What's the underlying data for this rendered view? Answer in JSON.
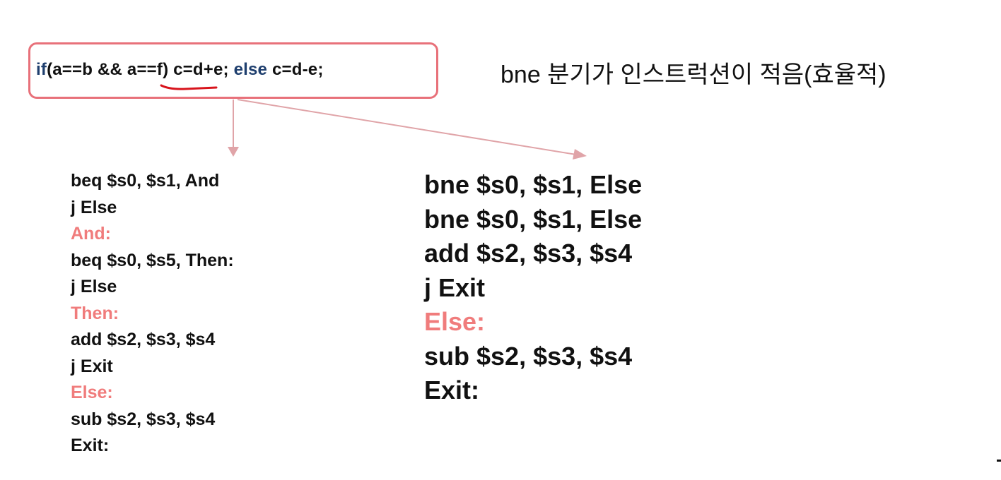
{
  "code": {
    "kw_if": "if",
    "part1": "(a==b && ",
    "underlined": "a==f",
    "part2": ") c=d+e; ",
    "kw_else": "else",
    "part3": " c=d-e;"
  },
  "note": "bne 분기가 인스트럭션이 적음(효율적)",
  "left_asm": [
    {
      "text": "beq $s0, $s1, And",
      "type": "instr"
    },
    {
      "text": "j Else",
      "type": "instr"
    },
    {
      "text": "And:",
      "type": "label"
    },
    {
      "text": "beq $s0, $s5, Then:",
      "type": "instr"
    },
    {
      "text": "j Else",
      "type": "instr"
    },
    {
      "text": "Then:",
      "type": "label"
    },
    {
      "text": "add $s2, $s3, $s4",
      "type": "instr"
    },
    {
      "text": "j Exit",
      "type": "instr"
    },
    {
      "text": "Else:",
      "type": "label"
    },
    {
      "text": "sub $s2, $s3, $s4",
      "type": "instr"
    },
    {
      "text": "Exit:",
      "type": "instr"
    }
  ],
  "right_asm": [
    {
      "text": "bne $s0, $s1, Else",
      "type": "instr"
    },
    {
      "text": "bne $s0, $s1, Else",
      "type": "instr"
    },
    {
      "text": "add $s2, $s3, $s4",
      "type": "instr"
    },
    {
      "text": "j Exit",
      "type": "instr"
    },
    {
      "text": "Else:",
      "type": "label"
    },
    {
      "text": "sub $s2, $s3, $s4",
      "type": "instr"
    },
    {
      "text": "Exit:",
      "type": "instr"
    }
  ],
  "colors": {
    "box_border": "#e8717a",
    "label": "#f07c7c",
    "keyword": "#1f3f6e",
    "underline": "#d8141c",
    "arrow": "#e0a4a8"
  }
}
